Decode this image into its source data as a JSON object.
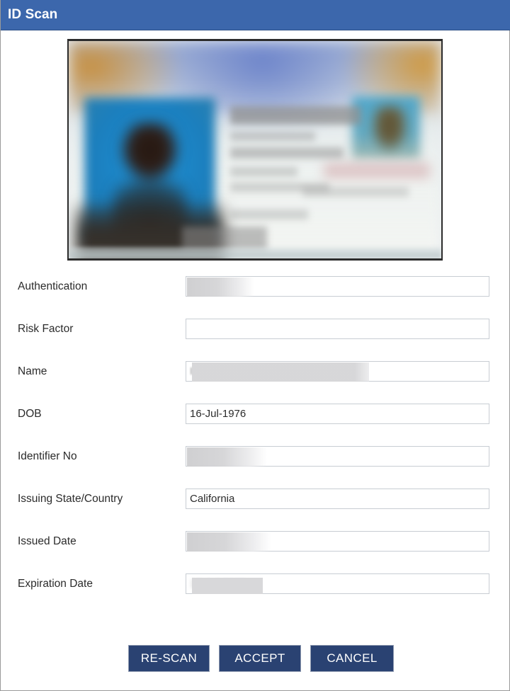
{
  "window": {
    "title": "ID Scan",
    "title_bar_color": "#3c67ac",
    "border_color": "#9a9a9a"
  },
  "scan_preview": {
    "name": "id-card-scan-image",
    "description": "Blurred scanned driver license image",
    "photo_background_color": "#1f91d6",
    "top_band_colors": [
      "#c89249",
      "#7b92cf",
      "#c89349"
    ]
  },
  "form": {
    "fields": [
      {
        "label": "Authentication",
        "value": "",
        "placeholder": "",
        "redacted": true,
        "redaction_style": "fade",
        "redaction_width": 95
      },
      {
        "label": "Risk Factor",
        "value": "",
        "placeholder": "",
        "redacted": false,
        "redaction_style": "",
        "redaction_width": 0
      },
      {
        "label": "Name",
        "value": "",
        "placeholder": "",
        "redacted": true,
        "redaction_style": "name",
        "redaction_width": 250
      },
      {
        "label": "DOB",
        "value": "16-Jul-1976",
        "placeholder": "",
        "redacted": false,
        "redaction_style": "",
        "redaction_width": 0
      },
      {
        "label": "Identifier No",
        "value": "",
        "placeholder": "",
        "redacted": true,
        "redaction_style": "fade",
        "redaction_width": 113
      },
      {
        "label": "Issuing State/Country",
        "value": "California",
        "placeholder": "",
        "redacted": false,
        "redaction_style": "",
        "redaction_width": 0
      },
      {
        "label": "Issued Date",
        "value": "",
        "placeholder": "",
        "redacted": true,
        "redaction_style": "fade",
        "redaction_width": 119
      },
      {
        "label": "Expiration Date",
        "value": "",
        "placeholder": "",
        "redacted": true,
        "redaction_style": "solid",
        "redaction_width": 100
      }
    ]
  },
  "buttons": {
    "rescan_label": "RE-SCAN",
    "accept_label": "ACCEPT",
    "cancel_label": "CANCEL",
    "color": "#2a4272",
    "text_color": "#ffffff"
  }
}
